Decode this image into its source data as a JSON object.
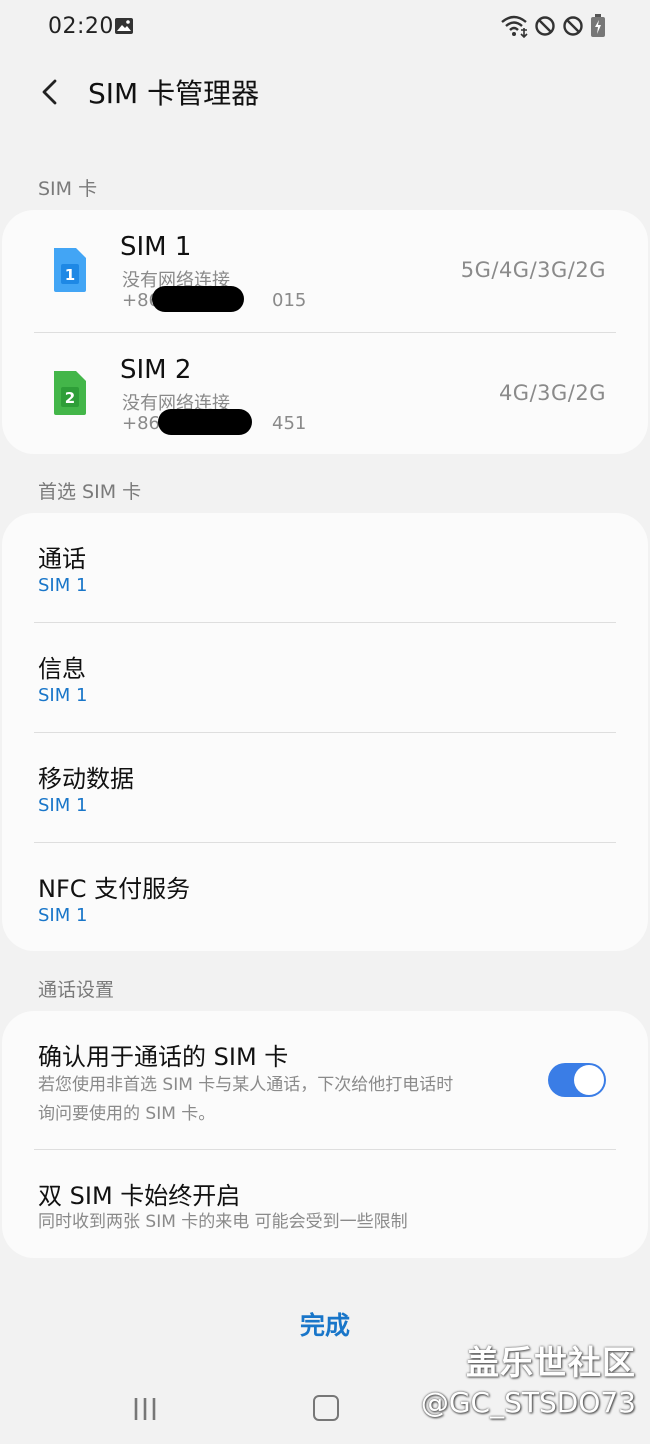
{
  "status_bar": {
    "time": "02:20",
    "icons": [
      "gallery-icon",
      "wifi-icon",
      "no-signal-icon",
      "no-signal-icon",
      "battery-charging-icon"
    ]
  },
  "header": {
    "title": "SIM 卡管理器",
    "back_icon": "chevron-left-icon"
  },
  "sim_section": {
    "header": "SIM 卡",
    "cards": [
      {
        "name": "SIM 1",
        "status": "没有网络连接",
        "number_prefix": "+86",
        "number_suffix": "015",
        "network": "5G/4G/3G/2G",
        "badge": "1",
        "color": "#42a5f5"
      },
      {
        "name": "SIM 2",
        "status": "没有网络连接",
        "number_prefix": "+86",
        "number_suffix": "451",
        "network": "4G/3G/2G",
        "badge": "2",
        "color": "#43b649"
      }
    ]
  },
  "preferred_section": {
    "header": "首选 SIM 卡",
    "items": [
      {
        "label": "通话",
        "value": "SIM 1"
      },
      {
        "label": "信息",
        "value": "SIM 1"
      },
      {
        "label": "移动数据",
        "value": "SIM 1"
      },
      {
        "label": "NFC 支付服务",
        "value": "SIM 1"
      }
    ]
  },
  "call_settings": {
    "header": "通话设置",
    "confirm": {
      "title": "确认用于通话的 SIM 卡",
      "desc_line1": "若您使用非首选 SIM 卡与某人通话，下次给他打电话时",
      "desc_line2": "询问要使用的 SIM 卡。",
      "enabled": true
    },
    "dual": {
      "title": "双 SIM 卡始终开启",
      "desc": "同时收到两张 SIM 卡的来电 可能会受到一些限制"
    }
  },
  "done_label": "完成",
  "nav": [
    "recent-apps-icon",
    "home-icon"
  ],
  "watermark": {
    "title": "盖乐世社区",
    "user": "@GC_STSDO73"
  },
  "colors": {
    "accent": "#1976c9",
    "toggle_on": "#3a7de6",
    "background": "#f2f2f2",
    "card": "#fbfbfb"
  }
}
